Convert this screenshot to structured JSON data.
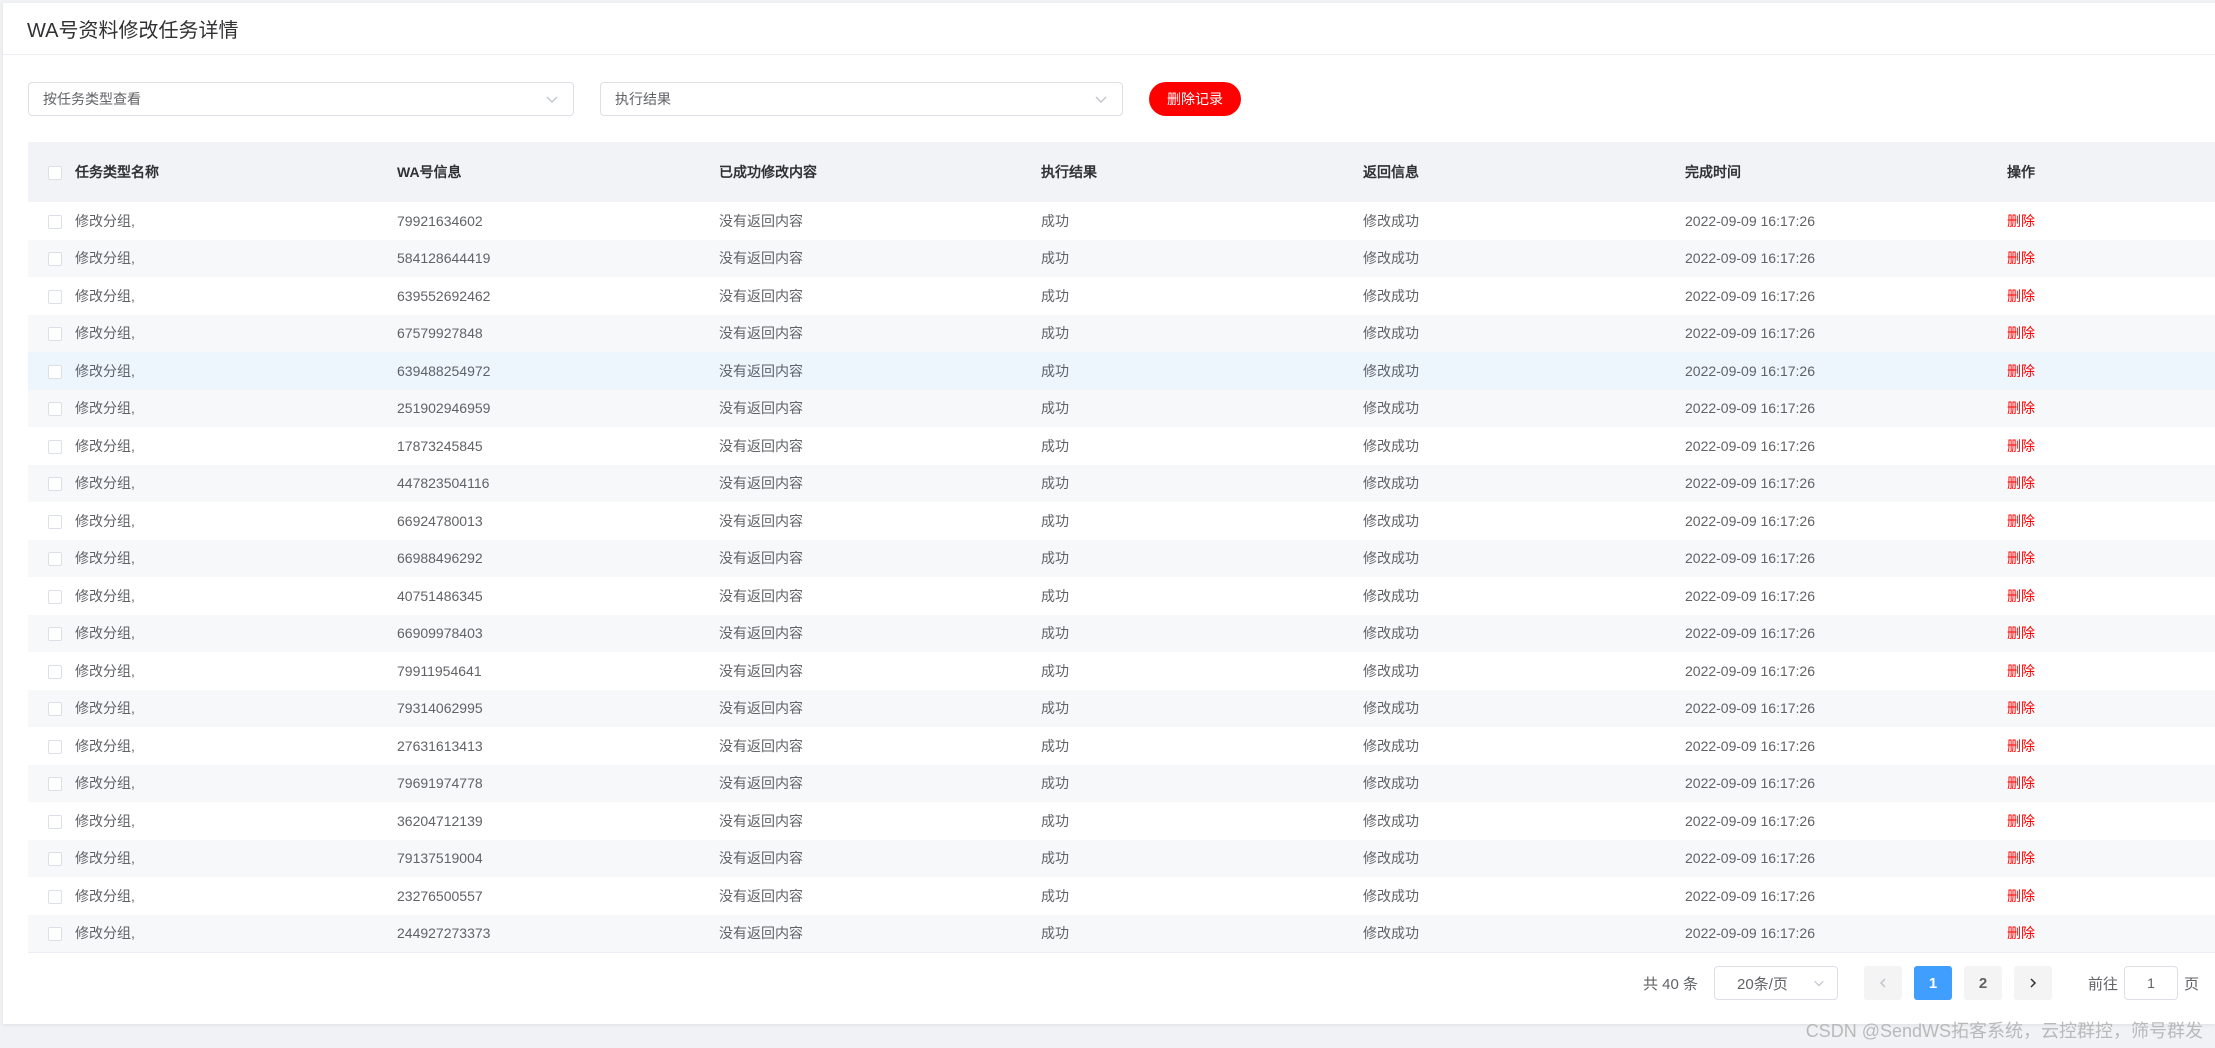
{
  "page": {
    "title": "WA号资料修改任务详情"
  },
  "filters": {
    "task_type_placeholder": "按任务类型查看",
    "result_placeholder": "执行结果",
    "delete_records_label": "删除记录"
  },
  "table": {
    "headers": {
      "task_type": "任务类型名称",
      "wa_info": "WA号信息",
      "changed": "已成功修改内容",
      "result": "执行结果",
      "message": "返回信息",
      "finished": "完成时间",
      "ops": "操作"
    },
    "rows": [
      {
        "task_type": "修改分组,",
        "wa_info": "79921634602",
        "changed": "没有返回内容",
        "result": "成功",
        "message": "修改成功",
        "finished": "2022-09-09 16:17:26",
        "op": "删除"
      },
      {
        "task_type": "修改分组,",
        "wa_info": "584128644419",
        "changed": "没有返回内容",
        "result": "成功",
        "message": "修改成功",
        "finished": "2022-09-09 16:17:26",
        "op": "删除"
      },
      {
        "task_type": "修改分组,",
        "wa_info": "639552692462",
        "changed": "没有返回内容",
        "result": "成功",
        "message": "修改成功",
        "finished": "2022-09-09 16:17:26",
        "op": "删除"
      },
      {
        "task_type": "修改分组,",
        "wa_info": "67579927848",
        "changed": "没有返回内容",
        "result": "成功",
        "message": "修改成功",
        "finished": "2022-09-09 16:17:26",
        "op": "删除"
      },
      {
        "task_type": "修改分组,",
        "wa_info": "639488254972",
        "changed": "没有返回内容",
        "result": "成功",
        "message": "修改成功",
        "finished": "2022-09-09 16:17:26",
        "op": "删除"
      },
      {
        "task_type": "修改分组,",
        "wa_info": "251902946959",
        "changed": "没有返回内容",
        "result": "成功",
        "message": "修改成功",
        "finished": "2022-09-09 16:17:26",
        "op": "删除"
      },
      {
        "task_type": "修改分组,",
        "wa_info": "17873245845",
        "changed": "没有返回内容",
        "result": "成功",
        "message": "修改成功",
        "finished": "2022-09-09 16:17:26",
        "op": "删除"
      },
      {
        "task_type": "修改分组,",
        "wa_info": "447823504116",
        "changed": "没有返回内容",
        "result": "成功",
        "message": "修改成功",
        "finished": "2022-09-09 16:17:26",
        "op": "删除"
      },
      {
        "task_type": "修改分组,",
        "wa_info": "66924780013",
        "changed": "没有返回内容",
        "result": "成功",
        "message": "修改成功",
        "finished": "2022-09-09 16:17:26",
        "op": "删除"
      },
      {
        "task_type": "修改分组,",
        "wa_info": "66988496292",
        "changed": "没有返回内容",
        "result": "成功",
        "message": "修改成功",
        "finished": "2022-09-09 16:17:26",
        "op": "删除"
      },
      {
        "task_type": "修改分组,",
        "wa_info": "40751486345",
        "changed": "没有返回内容",
        "result": "成功",
        "message": "修改成功",
        "finished": "2022-09-09 16:17:26",
        "op": "删除"
      },
      {
        "task_type": "修改分组,",
        "wa_info": "66909978403",
        "changed": "没有返回内容",
        "result": "成功",
        "message": "修改成功",
        "finished": "2022-09-09 16:17:26",
        "op": "删除"
      },
      {
        "task_type": "修改分组,",
        "wa_info": "79911954641",
        "changed": "没有返回内容",
        "result": "成功",
        "message": "修改成功",
        "finished": "2022-09-09 16:17:26",
        "op": "删除"
      },
      {
        "task_type": "修改分组,",
        "wa_info": "79314062995",
        "changed": "没有返回内容",
        "result": "成功",
        "message": "修改成功",
        "finished": "2022-09-09 16:17:26",
        "op": "删除"
      },
      {
        "task_type": "修改分组,",
        "wa_info": "27631613413",
        "changed": "没有返回内容",
        "result": "成功",
        "message": "修改成功",
        "finished": "2022-09-09 16:17:26",
        "op": "删除"
      },
      {
        "task_type": "修改分组,",
        "wa_info": "79691974778",
        "changed": "没有返回内容",
        "result": "成功",
        "message": "修改成功",
        "finished": "2022-09-09 16:17:26",
        "op": "删除"
      },
      {
        "task_type": "修改分组,",
        "wa_info": "36204712139",
        "changed": "没有返回内容",
        "result": "成功",
        "message": "修改成功",
        "finished": "2022-09-09 16:17:26",
        "op": "删除"
      },
      {
        "task_type": "修改分组,",
        "wa_info": "79137519004",
        "changed": "没有返回内容",
        "result": "成功",
        "message": "修改成功",
        "finished": "2022-09-09 16:17:26",
        "op": "删除"
      },
      {
        "task_type": "修改分组,",
        "wa_info": "23276500557",
        "changed": "没有返回内容",
        "result": "成功",
        "message": "修改成功",
        "finished": "2022-09-09 16:17:26",
        "op": "删除"
      },
      {
        "task_type": "修改分组,",
        "wa_info": "244927273373",
        "changed": "没有返回内容",
        "result": "成功",
        "message": "修改成功",
        "finished": "2022-09-09 16:17:26",
        "op": "删除"
      }
    ]
  },
  "pagination": {
    "total_text": "共 40 条",
    "page_size_label": "20条/页",
    "pages": [
      "1",
      "2"
    ],
    "current_page": "1",
    "goto_prefix": "前往",
    "goto_value": "1",
    "goto_suffix": "页"
  },
  "watermark": "CSDN @SendWS拓客系统，云控群控，筛号群发",
  "colors": {
    "danger": "#ff0000",
    "primary": "#409eff",
    "header_bg": "#f1f3f7"
  }
}
